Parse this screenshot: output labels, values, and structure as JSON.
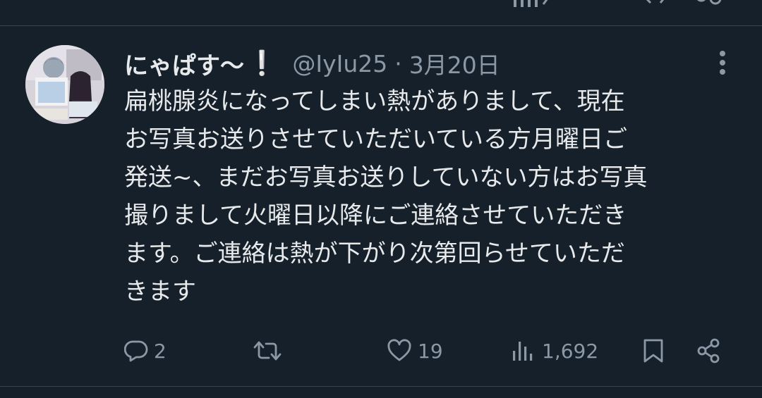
{
  "tweet": {
    "display_name": "にゃぱす〜",
    "name_emoji": "❕",
    "handle": "@IyIu25",
    "separator": "·",
    "date": "3月20日",
    "text_lines": [
      "扁桃腺炎になってしまい熱がありまして、現在",
      "お写真お送りさせていただいている方月曜日ご",
      "発送~、まだお写真お送りしていない方はお写真",
      "撮りまして火曜日以降にご連絡させていただき",
      "ます。ご連絡は熱が下がり次第回らせていただ",
      "きます"
    ]
  },
  "actions": {
    "replies": "2",
    "retweets": "",
    "likes": "19",
    "views": "1,692"
  },
  "icons": {
    "reply": "reply-icon",
    "retweet": "retweet-icon",
    "like": "heart-icon",
    "views": "views-icon",
    "bookmark": "bookmark-icon",
    "share": "share-icon",
    "more": "more-icon"
  },
  "colors": {
    "background": "#15202b",
    "text": "#e7e9ea",
    "secondary": "#8b98a5",
    "divider": "#38444d"
  }
}
